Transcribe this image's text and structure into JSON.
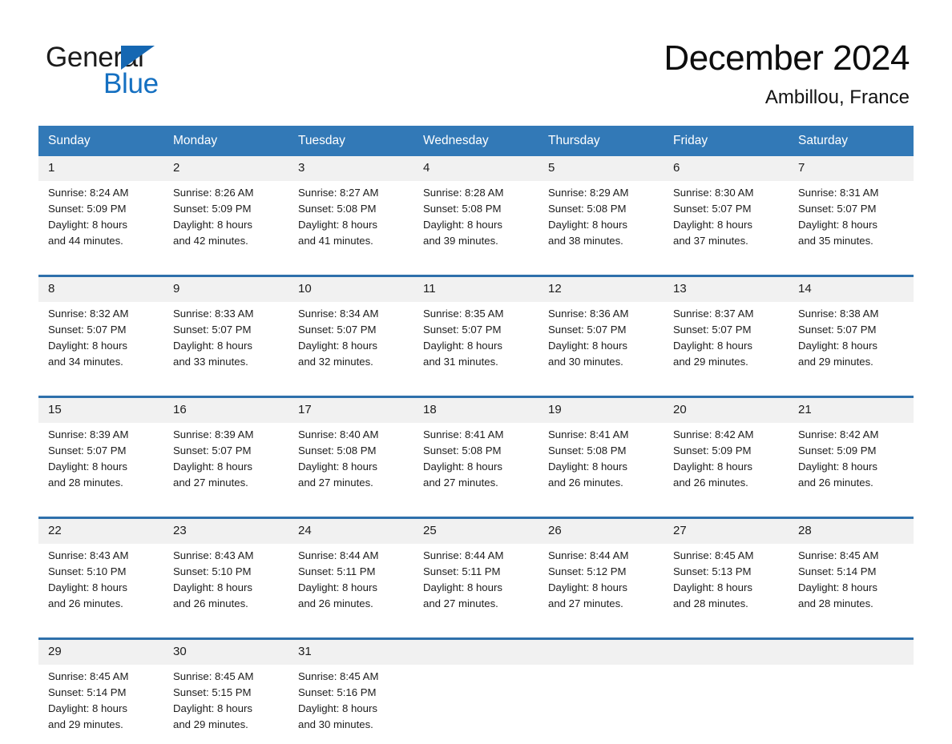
{
  "logo": {
    "word_one": "General",
    "word_two": "Blue",
    "triangle_color": "#1567b2",
    "blue_color": "#1570c1"
  },
  "header": {
    "month_title": "December 2024",
    "location": "Ambillou, France"
  },
  "theme": {
    "header_blue": "#3279b7",
    "separator_blue": "#2e70ab",
    "daynum_bg": "#f1f1f1",
    "text": "#1c1c1c"
  },
  "weekday_headers": [
    "Sunday",
    "Monday",
    "Tuesday",
    "Wednesday",
    "Thursday",
    "Friday",
    "Saturday"
  ],
  "weeks": [
    {
      "days": [
        {
          "num": "1",
          "sunrise": "Sunrise: 8:24 AM",
          "sunset": "Sunset: 5:09 PM",
          "daylight_1": "Daylight: 8 hours",
          "daylight_2": "and 44 minutes."
        },
        {
          "num": "2",
          "sunrise": "Sunrise: 8:26 AM",
          "sunset": "Sunset: 5:09 PM",
          "daylight_1": "Daylight: 8 hours",
          "daylight_2": "and 42 minutes."
        },
        {
          "num": "3",
          "sunrise": "Sunrise: 8:27 AM",
          "sunset": "Sunset: 5:08 PM",
          "daylight_1": "Daylight: 8 hours",
          "daylight_2": "and 41 minutes."
        },
        {
          "num": "4",
          "sunrise": "Sunrise: 8:28 AM",
          "sunset": "Sunset: 5:08 PM",
          "daylight_1": "Daylight: 8 hours",
          "daylight_2": "and 39 minutes."
        },
        {
          "num": "5",
          "sunrise": "Sunrise: 8:29 AM",
          "sunset": "Sunset: 5:08 PM",
          "daylight_1": "Daylight: 8 hours",
          "daylight_2": "and 38 minutes."
        },
        {
          "num": "6",
          "sunrise": "Sunrise: 8:30 AM",
          "sunset": "Sunset: 5:07 PM",
          "daylight_1": "Daylight: 8 hours",
          "daylight_2": "and 37 minutes."
        },
        {
          "num": "7",
          "sunrise": "Sunrise: 8:31 AM",
          "sunset": "Sunset: 5:07 PM",
          "daylight_1": "Daylight: 8 hours",
          "daylight_2": "and 35 minutes."
        }
      ]
    },
    {
      "days": [
        {
          "num": "8",
          "sunrise": "Sunrise: 8:32 AM",
          "sunset": "Sunset: 5:07 PM",
          "daylight_1": "Daylight: 8 hours",
          "daylight_2": "and 34 minutes."
        },
        {
          "num": "9",
          "sunrise": "Sunrise: 8:33 AM",
          "sunset": "Sunset: 5:07 PM",
          "daylight_1": "Daylight: 8 hours",
          "daylight_2": "and 33 minutes."
        },
        {
          "num": "10",
          "sunrise": "Sunrise: 8:34 AM",
          "sunset": "Sunset: 5:07 PM",
          "daylight_1": "Daylight: 8 hours",
          "daylight_2": "and 32 minutes."
        },
        {
          "num": "11",
          "sunrise": "Sunrise: 8:35 AM",
          "sunset": "Sunset: 5:07 PM",
          "daylight_1": "Daylight: 8 hours",
          "daylight_2": "and 31 minutes."
        },
        {
          "num": "12",
          "sunrise": "Sunrise: 8:36 AM",
          "sunset": "Sunset: 5:07 PM",
          "daylight_1": "Daylight: 8 hours",
          "daylight_2": "and 30 minutes."
        },
        {
          "num": "13",
          "sunrise": "Sunrise: 8:37 AM",
          "sunset": "Sunset: 5:07 PM",
          "daylight_1": "Daylight: 8 hours",
          "daylight_2": "and 29 minutes."
        },
        {
          "num": "14",
          "sunrise": "Sunrise: 8:38 AM",
          "sunset": "Sunset: 5:07 PM",
          "daylight_1": "Daylight: 8 hours",
          "daylight_2": "and 29 minutes."
        }
      ]
    },
    {
      "days": [
        {
          "num": "15",
          "sunrise": "Sunrise: 8:39 AM",
          "sunset": "Sunset: 5:07 PM",
          "daylight_1": "Daylight: 8 hours",
          "daylight_2": "and 28 minutes."
        },
        {
          "num": "16",
          "sunrise": "Sunrise: 8:39 AM",
          "sunset": "Sunset: 5:07 PM",
          "daylight_1": "Daylight: 8 hours",
          "daylight_2": "and 27 minutes."
        },
        {
          "num": "17",
          "sunrise": "Sunrise: 8:40 AM",
          "sunset": "Sunset: 5:08 PM",
          "daylight_1": "Daylight: 8 hours",
          "daylight_2": "and 27 minutes."
        },
        {
          "num": "18",
          "sunrise": "Sunrise: 8:41 AM",
          "sunset": "Sunset: 5:08 PM",
          "daylight_1": "Daylight: 8 hours",
          "daylight_2": "and 27 minutes."
        },
        {
          "num": "19",
          "sunrise": "Sunrise: 8:41 AM",
          "sunset": "Sunset: 5:08 PM",
          "daylight_1": "Daylight: 8 hours",
          "daylight_2": "and 26 minutes."
        },
        {
          "num": "20",
          "sunrise": "Sunrise: 8:42 AM",
          "sunset": "Sunset: 5:09 PM",
          "daylight_1": "Daylight: 8 hours",
          "daylight_2": "and 26 minutes."
        },
        {
          "num": "21",
          "sunrise": "Sunrise: 8:42 AM",
          "sunset": "Sunset: 5:09 PM",
          "daylight_1": "Daylight: 8 hours",
          "daylight_2": "and 26 minutes."
        }
      ]
    },
    {
      "days": [
        {
          "num": "22",
          "sunrise": "Sunrise: 8:43 AM",
          "sunset": "Sunset: 5:10 PM",
          "daylight_1": "Daylight: 8 hours",
          "daylight_2": "and 26 minutes."
        },
        {
          "num": "23",
          "sunrise": "Sunrise: 8:43 AM",
          "sunset": "Sunset: 5:10 PM",
          "daylight_1": "Daylight: 8 hours",
          "daylight_2": "and 26 minutes."
        },
        {
          "num": "24",
          "sunrise": "Sunrise: 8:44 AM",
          "sunset": "Sunset: 5:11 PM",
          "daylight_1": "Daylight: 8 hours",
          "daylight_2": "and 26 minutes."
        },
        {
          "num": "25",
          "sunrise": "Sunrise: 8:44 AM",
          "sunset": "Sunset: 5:11 PM",
          "daylight_1": "Daylight: 8 hours",
          "daylight_2": "and 27 minutes."
        },
        {
          "num": "26",
          "sunrise": "Sunrise: 8:44 AM",
          "sunset": "Sunset: 5:12 PM",
          "daylight_1": "Daylight: 8 hours",
          "daylight_2": "and 27 minutes."
        },
        {
          "num": "27",
          "sunrise": "Sunrise: 8:45 AM",
          "sunset": "Sunset: 5:13 PM",
          "daylight_1": "Daylight: 8 hours",
          "daylight_2": "and 28 minutes."
        },
        {
          "num": "28",
          "sunrise": "Sunrise: 8:45 AM",
          "sunset": "Sunset: 5:14 PM",
          "daylight_1": "Daylight: 8 hours",
          "daylight_2": "and 28 minutes."
        }
      ]
    },
    {
      "days": [
        {
          "num": "29",
          "sunrise": "Sunrise: 8:45 AM",
          "sunset": "Sunset: 5:14 PM",
          "daylight_1": "Daylight: 8 hours",
          "daylight_2": "and 29 minutes."
        },
        {
          "num": "30",
          "sunrise": "Sunrise: 8:45 AM",
          "sunset": "Sunset: 5:15 PM",
          "daylight_1": "Daylight: 8 hours",
          "daylight_2": "and 29 minutes."
        },
        {
          "num": "31",
          "sunrise": "Sunrise: 8:45 AM",
          "sunset": "Sunset: 5:16 PM",
          "daylight_1": "Daylight: 8 hours",
          "daylight_2": "and 30 minutes."
        },
        {
          "num": "",
          "sunrise": "",
          "sunset": "",
          "daylight_1": "",
          "daylight_2": ""
        },
        {
          "num": "",
          "sunrise": "",
          "sunset": "",
          "daylight_1": "",
          "daylight_2": ""
        },
        {
          "num": "",
          "sunrise": "",
          "sunset": "",
          "daylight_1": "",
          "daylight_2": ""
        },
        {
          "num": "",
          "sunrise": "",
          "sunset": "",
          "daylight_1": "",
          "daylight_2": ""
        }
      ]
    }
  ]
}
